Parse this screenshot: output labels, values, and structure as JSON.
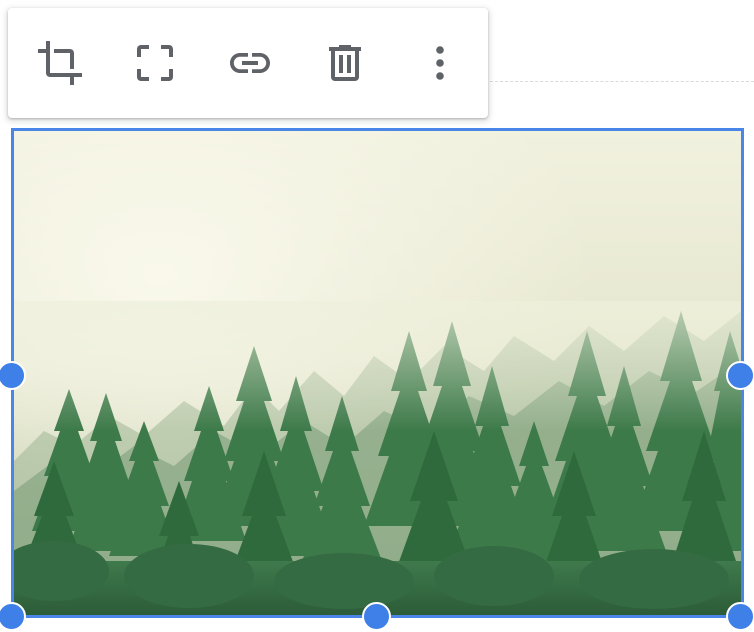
{
  "toolbar": {
    "buttons": [
      {
        "id": "crop",
        "icon": "crop-icon"
      },
      {
        "id": "fit",
        "icon": "fit-frame-icon"
      },
      {
        "id": "link",
        "icon": "link-icon"
      },
      {
        "id": "delete",
        "icon": "trash-icon"
      },
      {
        "id": "more",
        "icon": "more-vertical-icon"
      }
    ],
    "icon_color": "#5f6368"
  },
  "image": {
    "subject": "misty-pine-forest",
    "selected": true,
    "selection_color": "#4a86e8",
    "handles": [
      "middle-left",
      "middle-right",
      "bottom-left",
      "bottom-center",
      "bottom-right"
    ]
  }
}
